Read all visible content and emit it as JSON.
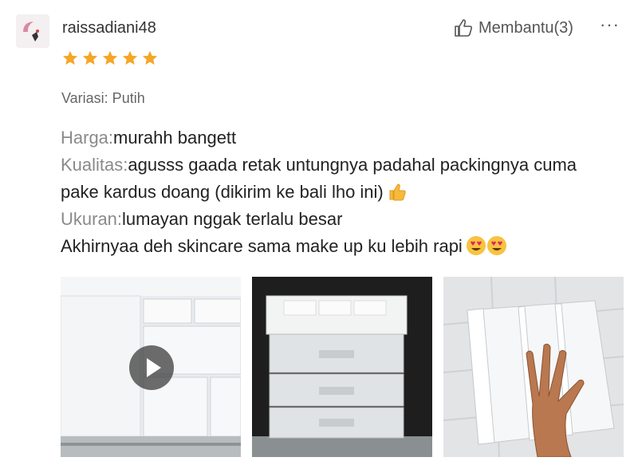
{
  "review": {
    "username": "raissadiani48",
    "helpful_label": "Membantu(3)",
    "more_label": "···",
    "rating": 5,
    "variant": "Variasi: Putih",
    "lines": {
      "harga_label": "Harga:",
      "harga_text": "murahh bangett",
      "kualitas_label": "Kualitas:",
      "kualitas_text": "agusss gaada retak untungnya padahal packingnya cuma pake kardus doang (dikirim ke bali lho ini)",
      "kualitas_emoji": "thumbs-up-emoji",
      "ukuran_label": "Ukuran:",
      "ukuran_text": "lumayan nggak terlalu besar",
      "closing_text": "Akhirnyaa deh skincare sama make up ku lebih rapi",
      "closing_emoji": "heart-eyes-emoji"
    }
  },
  "media": [
    {
      "kind": "video",
      "icon": "play-icon"
    },
    {
      "kind": "photo"
    },
    {
      "kind": "photo"
    }
  ],
  "colors": {
    "star": "#f5a623",
    "label_gray": "#8a8a8a",
    "text": "#222222"
  }
}
